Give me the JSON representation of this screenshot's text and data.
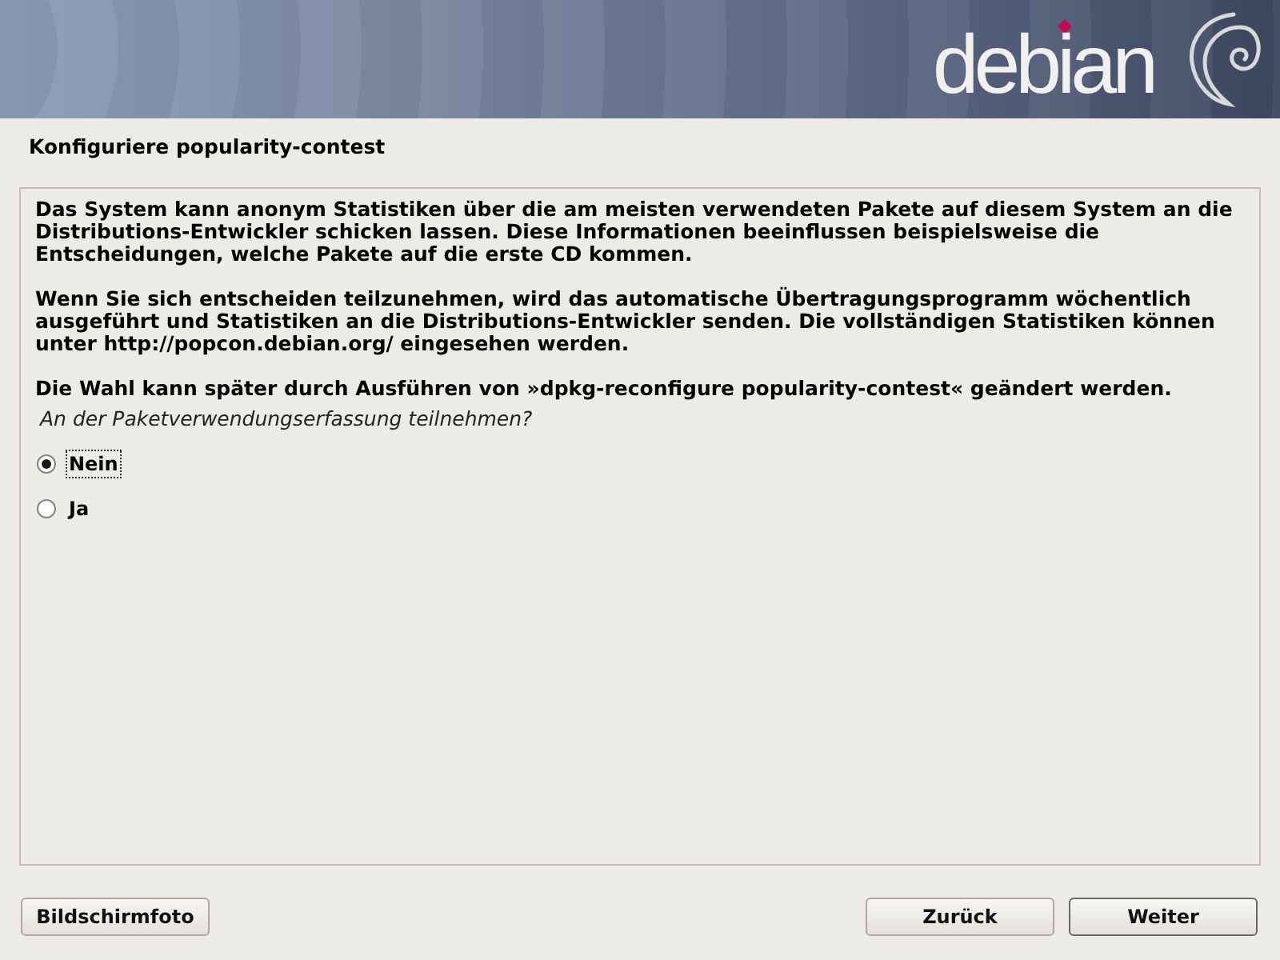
{
  "header": {
    "logo_text": "debian"
  },
  "title": "Konfiguriere popularity-contest",
  "paragraphs": [
    "Das System kann anonym Statistiken über die am meisten verwendeten Pakete auf diesem System an die Distributions-Entwickler schicken lassen. Diese Informationen beeinflussen beispielsweise die Entscheidungen, welche Pakete auf die erste CD kommen.",
    "Wenn Sie sich entscheiden teilzunehmen, wird das automatische Übertragungsprogramm wöchentlich ausgeführt und Statistiken an die Distributions-Entwickler senden. Die vollständigen Statistiken können unter http://popcon.debian.org/ eingesehen werden.",
    "Die Wahl kann später durch Ausführen von »dpkg-reconfigure popularity-contest« geändert werden."
  ],
  "question": "An der Paketverwendungserfassung teilnehmen?",
  "options": [
    {
      "label": "Nein",
      "selected": true
    },
    {
      "label": "Ja",
      "selected": false
    }
  ],
  "screenshot_button": {
    "label": "Bildschirmfoto"
  },
  "nav_buttons": [
    {
      "label": "Zurück",
      "default": false
    },
    {
      "label": "Weiter",
      "default": true
    }
  ]
}
